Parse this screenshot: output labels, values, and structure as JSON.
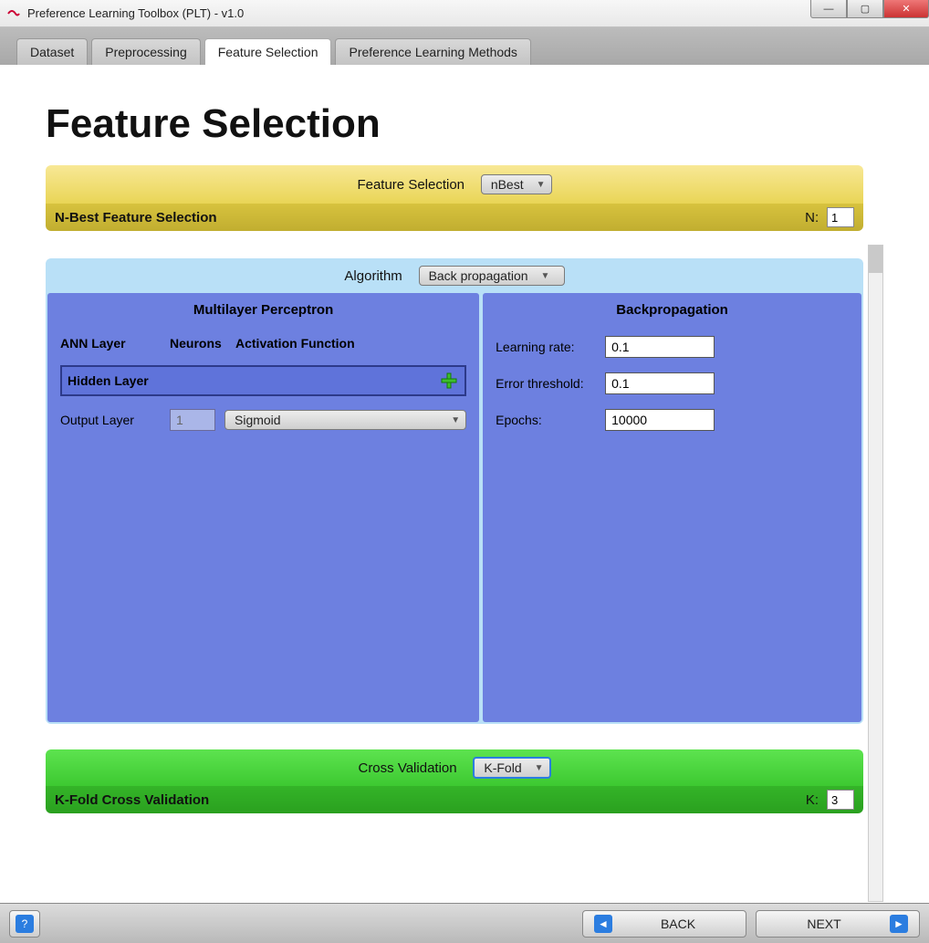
{
  "window": {
    "title": "Preference Learning Toolbox (PLT) - v1.0"
  },
  "tabs": [
    {
      "label": "Dataset"
    },
    {
      "label": "Preprocessing"
    },
    {
      "label": "Feature Selection"
    },
    {
      "label": "Preference Learning Methods"
    }
  ],
  "page": {
    "heading": "Feature Selection"
  },
  "feature_selection": {
    "label": "Feature Selection",
    "method": "nBest",
    "subtitle": "N-Best Feature Selection",
    "n_label": "N:",
    "n_value": "1"
  },
  "algorithm": {
    "label": "Algorithm",
    "selected": "Back propagation",
    "mlp_title": "Multilayer Perceptron",
    "cols": {
      "c1": "ANN Layer",
      "c2": "Neurons",
      "c3": "Activation Function"
    },
    "hidden_label": "Hidden Layer",
    "output_label": "Output Layer",
    "output_neurons": "1",
    "output_activation": "Sigmoid",
    "bp_title": "Backpropagation",
    "bp": {
      "lr_label": "Learning rate:",
      "lr_value": "0.1",
      "err_label": "Error threshold:",
      "err_value": "0.1",
      "ep_label": "Epochs:",
      "ep_value": "10000"
    }
  },
  "cv": {
    "label": "Cross Validation",
    "method": "K-Fold",
    "subtitle": "K-Fold Cross Validation",
    "k_label": "K:",
    "k_value": "3"
  },
  "nav": {
    "back": "BACK",
    "next": "NEXT"
  }
}
